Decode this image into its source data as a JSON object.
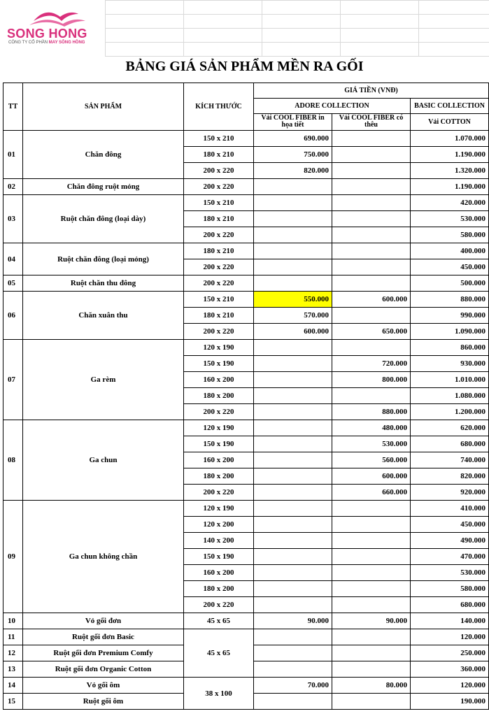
{
  "brand": {
    "name": "SONG HONG",
    "subtitle_a": "CÔNG TY CỔ PHẦN",
    "subtitle_b": "MAY SÔNG HỒNG"
  },
  "title": "BẢNG GIÁ SẢN PHẨM MỀN RA GỐI",
  "headers": {
    "tt": "TT",
    "product": "SẢN PHẨM",
    "size": "KÍCH THƯỚC",
    "price": "GIÁ TIỀN (VNĐ)",
    "adore": "ADORE COLLECTION",
    "basic": "BASIC COLLECTION",
    "col_a": "Vải COOL FIBER in họa tiết",
    "col_b": "Vải COOL FIBER có thêu",
    "col_c": "Vải COTTON"
  },
  "groups": [
    {
      "tt": "01",
      "name": "Chăn đông",
      "rows": [
        {
          "size": "150 x 210",
          "a": "690.000",
          "b": "",
          "c": "1.070.000"
        },
        {
          "size": "180 x 210",
          "a": "750.000",
          "b": "",
          "c": "1.190.000"
        },
        {
          "size": "200 x 220",
          "a": "820.000",
          "b": "",
          "c": "1.320.000"
        }
      ]
    },
    {
      "tt": "02",
      "name": "Chăn đông ruột mỏng",
      "rows": [
        {
          "size": "200 x 220",
          "a": "",
          "b": "",
          "c": "1.190.000"
        }
      ]
    },
    {
      "tt": "03",
      "name": "Ruột chăn đông (loại dày)",
      "rows": [
        {
          "size": "150 x 210",
          "a": "",
          "b": "",
          "c": "420.000"
        },
        {
          "size": "180 x 210",
          "a": "",
          "b": "",
          "c": "530.000"
        },
        {
          "size": "200 x 220",
          "a": "",
          "b": "",
          "c": "580.000"
        }
      ]
    },
    {
      "tt": "04",
      "name": "Ruột chăn đông (loại mỏng)",
      "rows": [
        {
          "size": "180 x 210",
          "a": "",
          "b": "",
          "c": "400.000"
        },
        {
          "size": "200 x 220",
          "a": "",
          "b": "",
          "c": "450.000"
        }
      ]
    },
    {
      "tt": "05",
      "name": "Ruột chăn thu đông",
      "rows": [
        {
          "size": "200 x 220",
          "a": "",
          "b": "",
          "c": "500.000"
        }
      ]
    },
    {
      "tt": "06",
      "name": "Chăn xuân thu",
      "rows": [
        {
          "size": "150 x 210",
          "a": "550.000",
          "b": "600.000",
          "c": "880.000",
          "hl": true
        },
        {
          "size": "180 x 210",
          "a": "570.000",
          "b": "",
          "c": "990.000"
        },
        {
          "size": "200 x 220",
          "a": "600.000",
          "b": "650.000",
          "c": "1.090.000"
        }
      ]
    },
    {
      "tt": "07",
      "name": "Ga rèm",
      "rows": [
        {
          "size": "120 x 190",
          "a": "",
          "b": "",
          "c": "860.000"
        },
        {
          "size": "150 x 190",
          "a": "",
          "b": "720.000",
          "c": "930.000"
        },
        {
          "size": "160 x 200",
          "a": "",
          "b": "800.000",
          "c": "1.010.000"
        },
        {
          "size": "180 x 200",
          "a": "",
          "b": "",
          "c": "1.080.000"
        },
        {
          "size": "200 x 220",
          "a": "",
          "b": "880.000",
          "c": "1.200.000"
        }
      ]
    },
    {
      "tt": "08",
      "name": "Ga chun",
      "rows": [
        {
          "size": "120 x 190",
          "a": "",
          "b": "480.000",
          "c": "620.000"
        },
        {
          "size": "150 x 190",
          "a": "",
          "b": "530.000",
          "c": "680.000"
        },
        {
          "size": "160 x 200",
          "a": "",
          "b": "560.000",
          "c": "740.000"
        },
        {
          "size": "180 x 200",
          "a": "",
          "b": "600.000",
          "c": "820.000"
        },
        {
          "size": "200 x 220",
          "a": "",
          "b": "660.000",
          "c": "920.000"
        }
      ]
    },
    {
      "tt": "09",
      "name": "Ga chun không chần",
      "rows": [
        {
          "size": "120 x 190",
          "a": "",
          "b": "",
          "c": "410.000"
        },
        {
          "size": "120 x 200",
          "a": "",
          "b": "",
          "c": "450.000"
        },
        {
          "size": "140 x 200",
          "a": "",
          "b": "",
          "c": "490.000"
        },
        {
          "size": "150 x 190",
          "a": "",
          "b": "",
          "c": "470.000"
        },
        {
          "size": "160 x 200",
          "a": "",
          "b": "",
          "c": "530.000"
        },
        {
          "size": "180 x 200",
          "a": "",
          "b": "",
          "c": "580.000"
        },
        {
          "size": "200 x 220",
          "a": "",
          "b": "",
          "c": "680.000"
        }
      ]
    },
    {
      "tt": "10",
      "name": "Vỏ gối đơn",
      "rows": [
        {
          "size": "45 x 65",
          "a": "90.000",
          "b": "90.000",
          "c": "140.000"
        }
      ]
    }
  ],
  "pillow_group": {
    "size": "45 x 65",
    "rows": [
      {
        "tt": "11",
        "name": "Ruột gối đơn Basic",
        "a": "",
        "b": "",
        "c": "120.000"
      },
      {
        "tt": "12",
        "name": "Ruột gối đơn Premium Comfy",
        "a": "",
        "b": "",
        "c": "250.000"
      },
      {
        "tt": "13",
        "name": "Ruột gối đơn Organic Cotton",
        "a": "",
        "b": "",
        "c": "360.000"
      }
    ]
  },
  "hug_group": {
    "size": "38 x 100",
    "rows": [
      {
        "tt": "14",
        "name": "Vỏ gối ôm",
        "a": "70.000",
        "b": "80.000",
        "c": "120.000"
      },
      {
        "tt": "15",
        "name": "Ruột gối ôm",
        "a": "",
        "b": "",
        "c": "190.000"
      }
    ]
  }
}
